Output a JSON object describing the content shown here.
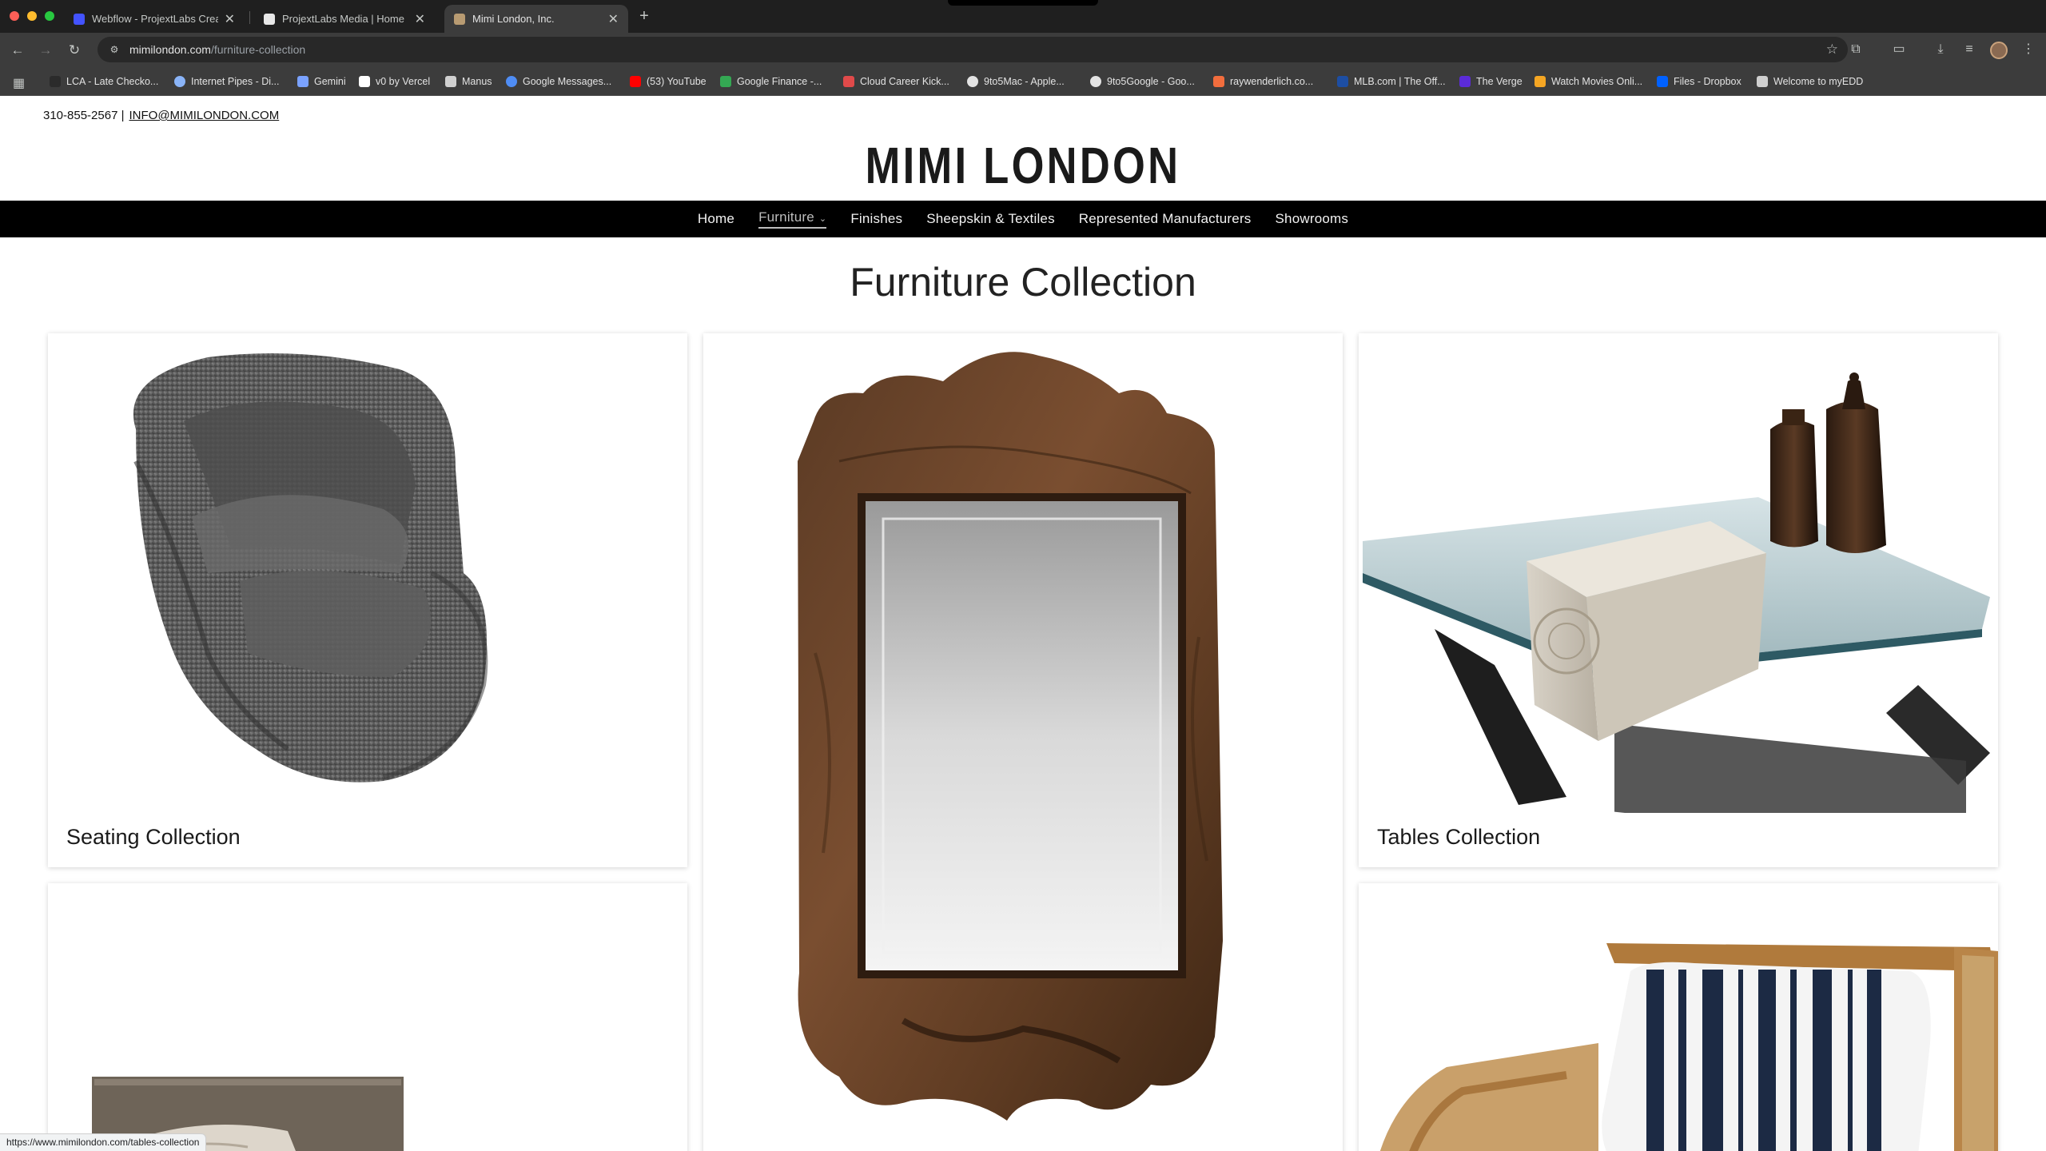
{
  "browser": {
    "tabs": [
      {
        "title": "Webflow - ProjextLabs Creat",
        "favicon_color": "#4353ff",
        "active": false
      },
      {
        "title": "ProjextLabs Media | Home",
        "favicon_color": "#e8e8e8",
        "active": false
      },
      {
        "title": "Mimi London, Inc.",
        "favicon_color": "#b89b72",
        "active": true
      }
    ],
    "url_host": "mimilondon.com",
    "url_path": "/furniture-collection",
    "bookmarks": [
      {
        "label": "LCA - Late Checko...",
        "color": "#2b2b2b"
      },
      {
        "label": "Internet Pipes - Di...",
        "color": "#8ab4f8"
      },
      {
        "label": "Gemini",
        "color": "#7aa2ff"
      },
      {
        "label": "v0 by Vercel",
        "color": "#ffffff"
      },
      {
        "label": "Manus",
        "color": "#d0d0d0"
      },
      {
        "label": "Google Messages...",
        "color": "#4f8df5"
      },
      {
        "label": "(53) YouTube",
        "color": "#ff0000"
      },
      {
        "label": "Google Finance -...",
        "color": "#34a853"
      },
      {
        "label": "Cloud Career Kick...",
        "color": "#e04a4a"
      },
      {
        "label": "9to5Mac - Apple...",
        "color": "#e3e3e3"
      },
      {
        "label": "9to5Google - Goo...",
        "color": "#e3e3e3"
      },
      {
        "label": "raywenderlich.co...",
        "color": "#f26d3d"
      },
      {
        "label": "MLB.com | The Off...",
        "color": "#1d4ea3"
      },
      {
        "label": "The Verge",
        "color": "#5b2bd8"
      },
      {
        "label": "Watch Movies Onli...",
        "color": "#f5a623"
      },
      {
        "label": "Files - Dropbox",
        "color": "#0061ff"
      },
      {
        "label": "Welcome to myEDD",
        "color": "#cfcfcf"
      }
    ],
    "status_url": "https://www.mimilondon.com/tables-collection"
  },
  "site": {
    "phone": "310-855-2567 |",
    "email": "INFO@MIMILONDON.COM",
    "brand": "MIMI LONDON",
    "nav": {
      "home": "Home",
      "furniture": "Furniture",
      "finishes": "Finishes",
      "sheepskin": "Sheepskin & Textiles",
      "manufacturers": "Represented Manufacturers",
      "showrooms": "Showrooms"
    },
    "page_title": "Furniture Collection",
    "cards": {
      "seating": "Seating Collection",
      "tables": "Tables Collection"
    }
  }
}
